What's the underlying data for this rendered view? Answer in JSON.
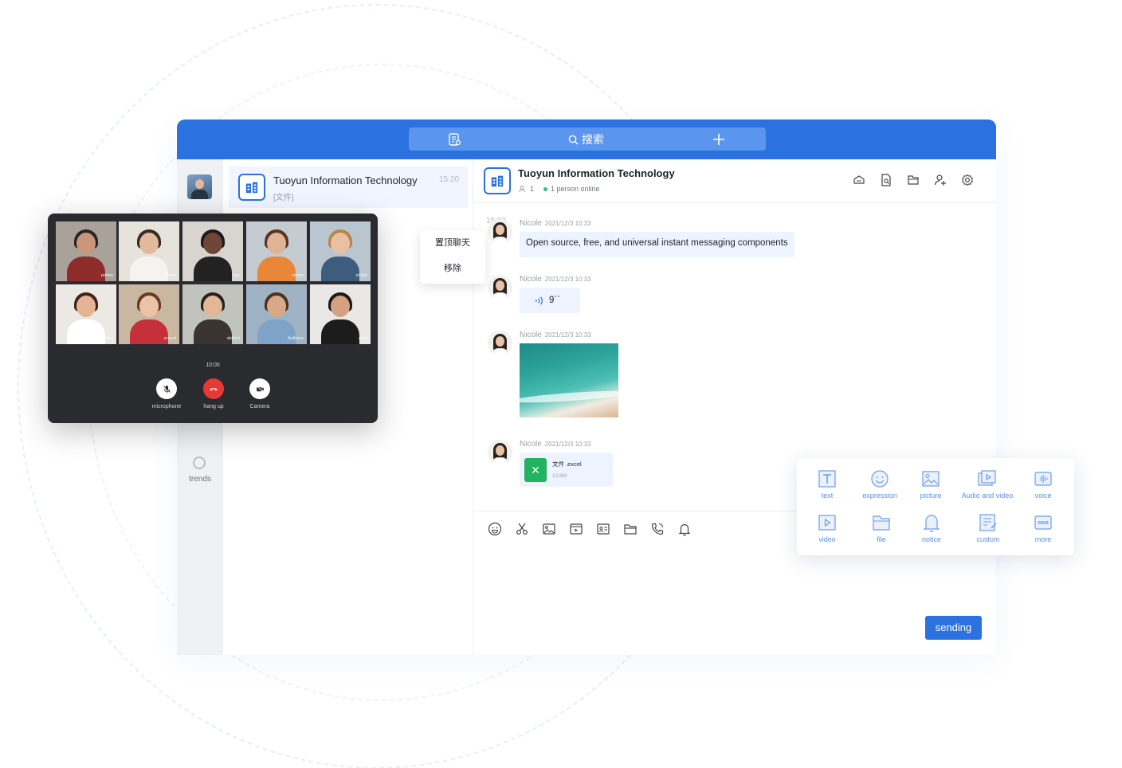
{
  "topbar": {
    "search_label": "搜索",
    "left_icon": "contacts-icon",
    "right_icon": "plus-icon",
    "accent": "#2b72e0"
  },
  "rail": {
    "trends_label": "trends"
  },
  "conversation": {
    "title": "Tuoyun Information Technology",
    "subtitle": "[文件]",
    "time": "15:20",
    "second_time": "15:20"
  },
  "context_menu": {
    "items": [
      "置顶聊天",
      "移除"
    ]
  },
  "chat": {
    "title": "Tuoyun Information Technology",
    "member_count": "1",
    "online_text": "1 person online",
    "header_icons": [
      "announcement-icon",
      "search-file-icon",
      "folder-icon",
      "add-member-icon",
      "settings-icon"
    ],
    "messages": [
      {
        "sender": "Nicole",
        "time": "2021/12/3  10:33",
        "text": "Open source, free, and universal instant messaging components"
      },
      {
        "sender": "Nicole",
        "time": "2021/12/3  10:33",
        "voice": "9``"
      },
      {
        "sender": "Nicole",
        "time": "2021/12/3  10:33",
        "image": "beach-photo"
      },
      {
        "sender": "Nicole",
        "time": "2021/12/3  10:33",
        "file_name": "文件 .excel",
        "file_size": "12.8M"
      }
    ],
    "toolbar_icons": [
      "emoji-icon",
      "scissors-icon",
      "image-icon",
      "video-icon",
      "card-icon",
      "folder-icon",
      "phone-icon",
      "bell-icon"
    ],
    "send_label": "sending"
  },
  "message_types": {
    "items": [
      {
        "label": "text",
        "icon": "text-icon"
      },
      {
        "label": "expression",
        "icon": "expression-icon"
      },
      {
        "label": "picture",
        "icon": "picture-icon"
      },
      {
        "label": "Audio and video",
        "icon": "audio-video-icon"
      },
      {
        "label": "voice",
        "icon": "voice-icon"
      },
      {
        "label": "video",
        "icon": "video-icon"
      },
      {
        "label": "file",
        "icon": "file-icon"
      },
      {
        "label": "notice",
        "icon": "notice-icon"
      },
      {
        "label": "custom",
        "icon": "custom-icon"
      },
      {
        "label": "more",
        "icon": "more-icon"
      }
    ]
  },
  "call": {
    "participants": [
      "peiton",
      "Nicole",
      "zoe",
      "venus",
      "stellar",
      "danika",
      "ernest",
      "aldrich",
      "Anthony",
      "gary"
    ],
    "timer": "10:00",
    "buttons": {
      "microphone": "microphone",
      "hangup": "hang up",
      "camera": "Camera"
    },
    "hangup_color": "#e53935"
  }
}
